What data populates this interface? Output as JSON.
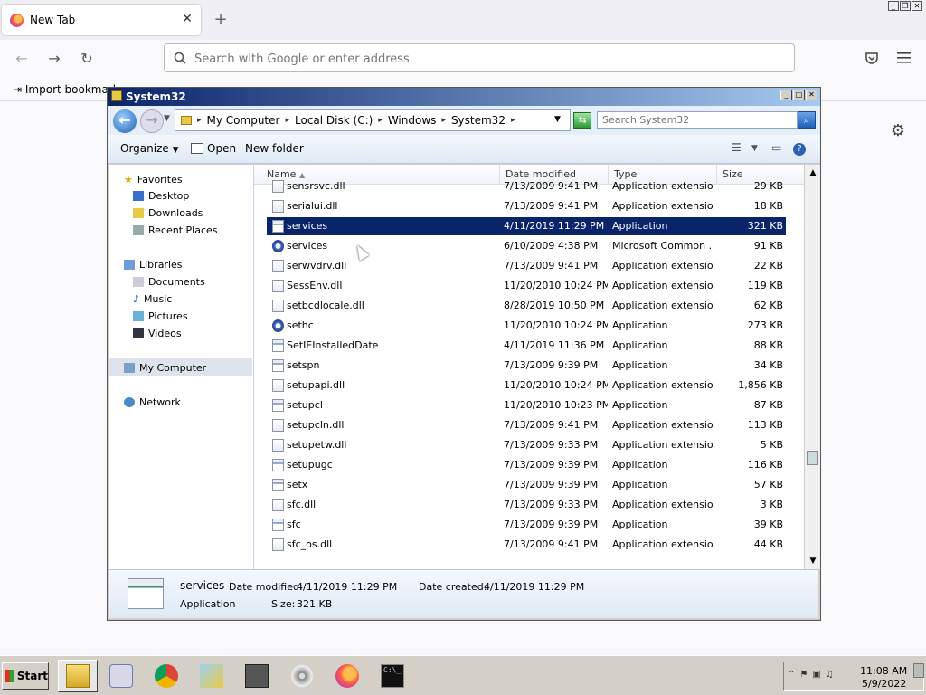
{
  "browser": {
    "tab_title": "New Tab",
    "tab_close": "✕",
    "new_tab": "+",
    "url_placeholder": "Search with Google or enter address",
    "bookmark_item": "Import bookmarks..."
  },
  "explorer": {
    "title": "System32",
    "breadcrumb": [
      "My Computer",
      "Local Disk (C:)",
      "Windows",
      "System32"
    ],
    "search_placeholder": "Search System32",
    "toolbar": {
      "organize": "Organize",
      "open": "Open",
      "new_folder": "New folder"
    },
    "nav": {
      "favorites": "Favorites",
      "desktop": "Desktop",
      "downloads": "Downloads",
      "recent_places": "Recent Places",
      "libraries": "Libraries",
      "documents": "Documents",
      "music": "Music",
      "pictures": "Pictures",
      "videos": "Videos",
      "my_computer": "My Computer",
      "network": "Network"
    },
    "columns": {
      "name": "Name",
      "date": "Date modified",
      "type": "Type",
      "size": "Size"
    },
    "files": [
      {
        "name": "sensrsvc.dll",
        "date": "7/13/2009 9:41 PM",
        "type": "Application extension",
        "size": "29 KB",
        "icon": "dll-icon"
      },
      {
        "name": "serialui.dll",
        "date": "7/13/2009 9:41 PM",
        "type": "Application extension",
        "size": "18 KB",
        "icon": "dll-icon"
      },
      {
        "name": "services",
        "date": "4/11/2019 11:29 PM",
        "type": "Application",
        "size": "321 KB",
        "icon": "app-icon"
      },
      {
        "name": "services",
        "date": "6/10/2009 4:38 PM",
        "type": "Microsoft Common ...",
        "size": "91 KB",
        "icon": "msc-icon"
      },
      {
        "name": "serwvdrv.dll",
        "date": "7/13/2009 9:41 PM",
        "type": "Application extension",
        "size": "22 KB",
        "icon": "dll-icon"
      },
      {
        "name": "SessEnv.dll",
        "date": "11/20/2010 10:24 PM",
        "type": "Application extension",
        "size": "119 KB",
        "icon": "dll-icon"
      },
      {
        "name": "setbcdlocale.dll",
        "date": "8/28/2019 10:50 PM",
        "type": "Application extension",
        "size": "62 KB",
        "icon": "dll-icon"
      },
      {
        "name": "sethc",
        "date": "11/20/2010 10:24 PM",
        "type": "Application",
        "size": "273 KB",
        "icon": "sethc-icon"
      },
      {
        "name": "SetIEInstalledDate",
        "date": "4/11/2019 11:36 PM",
        "type": "Application",
        "size": "88 KB",
        "icon": "app-icon"
      },
      {
        "name": "setspn",
        "date": "7/13/2009 9:39 PM",
        "type": "Application",
        "size": "34 KB",
        "icon": "app-icon"
      },
      {
        "name": "setupapi.dll",
        "date": "11/20/2010 10:24 PM",
        "type": "Application extension",
        "size": "1,856 KB",
        "icon": "dll-icon"
      },
      {
        "name": "setupcl",
        "date": "11/20/2010 10:23 PM",
        "type": "Application",
        "size": "87 KB",
        "icon": "app-icon"
      },
      {
        "name": "setupcln.dll",
        "date": "7/13/2009 9:41 PM",
        "type": "Application extension",
        "size": "113 KB",
        "icon": "dll-icon"
      },
      {
        "name": "setupetw.dll",
        "date": "7/13/2009 9:33 PM",
        "type": "Application extension",
        "size": "5 KB",
        "icon": "dll-icon"
      },
      {
        "name": "setupugc",
        "date": "7/13/2009 9:39 PM",
        "type": "Application",
        "size": "116 KB",
        "icon": "app-icon"
      },
      {
        "name": "setx",
        "date": "7/13/2009 9:39 PM",
        "type": "Application",
        "size": "57 KB",
        "icon": "app-icon"
      },
      {
        "name": "sfc.dll",
        "date": "7/13/2009 9:33 PM",
        "type": "Application extension",
        "size": "3 KB",
        "icon": "dll-icon"
      },
      {
        "name": "sfc",
        "date": "7/13/2009 9:39 PM",
        "type": "Application",
        "size": "39 KB",
        "icon": "app-icon"
      },
      {
        "name": "sfc_os.dll",
        "date": "7/13/2009 9:41 PM",
        "type": "Application extension",
        "size": "44 KB",
        "icon": "dll-icon"
      }
    ],
    "selected_index": 2,
    "details": {
      "name": "services",
      "type": "Application",
      "modified_label": "Date modified:",
      "modified": "4/11/2019 11:29 PM",
      "created_label": "Date created:",
      "created": "4/11/2019 11:29 PM",
      "size_label": "Size:",
      "size": "321 KB"
    }
  },
  "taskbar": {
    "start": "Start",
    "clock_time": "11:08 AM",
    "clock_date": "5/9/2022"
  },
  "colors": {
    "selection": "#0a246a",
    "titlebar": "#0a246a",
    "chrome_bg": "#f0f0f4"
  }
}
